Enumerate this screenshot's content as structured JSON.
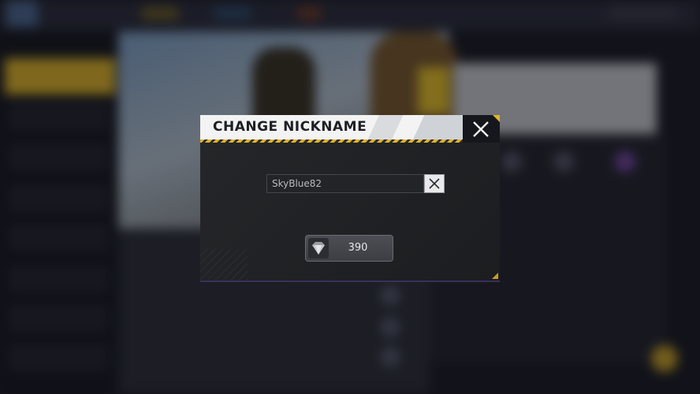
{
  "dialog": {
    "title": "CHANGE NICKNAME",
    "close_icon": "close-icon",
    "nickname_input": {
      "value": "SkyBlue82"
    },
    "clear_icon": "close-icon",
    "confirm": {
      "price": "390",
      "currency_icon": "diamond-icon"
    }
  },
  "colors": {
    "accent": "#e0b32a",
    "dialog_bg": "#222326",
    "header_bg": "#f3f3f3"
  }
}
